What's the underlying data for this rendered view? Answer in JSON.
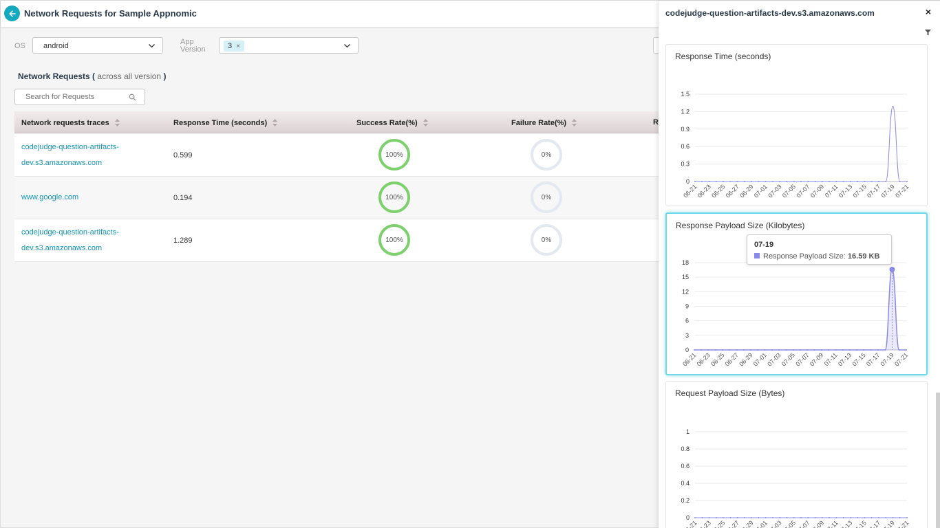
{
  "header": {
    "title": "Network Requests for Sample Appnomic"
  },
  "filters": {
    "os_label": "OS",
    "os_value": "android",
    "app_version_label_1": "App",
    "app_version_label_2": "Version",
    "app_version_tag": "3"
  },
  "section": {
    "title": "Network Requests",
    "paren_open": "(",
    "subtitle": "across all version",
    "paren_close": ")"
  },
  "search": {
    "placeholder": "Search for Requests"
  },
  "table": {
    "columns": [
      "Network requests traces",
      "Response Time (seconds)",
      "Success Rate(%)",
      "Failure Rate(%)",
      "R"
    ],
    "rows": [
      {
        "trace_line1": "codejudge-question-artifacts-",
        "trace_line2": "dev.s3.amazonaws.com",
        "response_time": "0.599",
        "success": "100%",
        "failure": "0%"
      },
      {
        "trace_line1": "www.google.com",
        "trace_line2": "",
        "response_time": "0.194",
        "success": "100%",
        "failure": "0%"
      },
      {
        "trace_line1": "codejudge-question-artifacts-",
        "trace_line2": "dev.s3.amazonaws.com",
        "response_time": "1.289",
        "success": "100%",
        "failure": "0%"
      }
    ]
  },
  "panel": {
    "title": "codejudge-question-artifacts-dev.s3.amazonaws.com",
    "close_label": "×"
  },
  "colors": {
    "accent": "#15a9bf",
    "link": "#1494b4",
    "success": "#7ed06e",
    "series": "#8a8ae6"
  },
  "chart_data": [
    {
      "type": "line",
      "title": "Response Time (seconds)",
      "x": [
        "06-21",
        "06-22",
        "06-23",
        "06-24",
        "06-25",
        "06-26",
        "06-27",
        "06-28",
        "06-29",
        "06-30",
        "07-01",
        "07-02",
        "07-03",
        "07-04",
        "07-05",
        "07-06",
        "07-07",
        "07-08",
        "07-09",
        "07-10",
        "07-11",
        "07-12",
        "07-13",
        "07-14",
        "07-15",
        "07-16",
        "07-17",
        "07-18",
        "07-19",
        "07-20",
        "07-21"
      ],
      "x_tick_labels": [
        "06-21",
        "06-23",
        "06-25",
        "06-27",
        "06-29",
        "07-01",
        "07-03",
        "07-05",
        "07-07",
        "07-09",
        "07-11",
        "07-13",
        "07-15",
        "07-17",
        "07-19",
        "07-21"
      ],
      "y_ticks": [
        "0",
        "0.3",
        "0.6",
        "0.9",
        "1.2",
        "1.5"
      ],
      "ylim": [
        0,
        1.5
      ],
      "series": [
        {
          "values": [
            0,
            0,
            0,
            0,
            0,
            0,
            0,
            0,
            0,
            0,
            0,
            0,
            0,
            0,
            0,
            0,
            0,
            0,
            0,
            0,
            0,
            0,
            0,
            0,
            0,
            0,
            0,
            0,
            1.289,
            0,
            0
          ]
        }
      ]
    },
    {
      "type": "area",
      "title": "Response Payload Size (Kilobytes)",
      "x": [
        "06-21",
        "06-22",
        "06-23",
        "06-24",
        "06-25",
        "06-26",
        "06-27",
        "06-28",
        "06-29",
        "06-30",
        "07-01",
        "07-02",
        "07-03",
        "07-04",
        "07-05",
        "07-06",
        "07-07",
        "07-08",
        "07-09",
        "07-10",
        "07-11",
        "07-12",
        "07-13",
        "07-14",
        "07-15",
        "07-16",
        "07-17",
        "07-18",
        "07-19",
        "07-20",
        "07-21"
      ],
      "x_tick_labels": [
        "06-21",
        "06-23",
        "06-25",
        "06-27",
        "06-29",
        "07-01",
        "07-03",
        "07-05",
        "07-07",
        "07-09",
        "07-11",
        "07-13",
        "07-15",
        "07-17",
        "07-19",
        "07-21"
      ],
      "y_ticks": [
        "0",
        "3",
        "6",
        "9",
        "12",
        "15",
        "18"
      ],
      "ylim": [
        0,
        18
      ],
      "series": [
        {
          "values": [
            0,
            0,
            0,
            0,
            0,
            0,
            0,
            0,
            0,
            0,
            0,
            0,
            0,
            0,
            0,
            0,
            0,
            0,
            0,
            0,
            0,
            0,
            0,
            0,
            0,
            0,
            0,
            0,
            16.59,
            0,
            0
          ]
        }
      ],
      "tooltip": {
        "date": "07-19",
        "label": "Response Payload Size:",
        "value": "16.59 KB"
      }
    },
    {
      "type": "line",
      "title": "Request Payload Size (Bytes)",
      "x": [
        "06-21",
        "06-22",
        "06-23",
        "06-24",
        "06-25",
        "06-26",
        "06-27",
        "06-28",
        "06-29",
        "06-30",
        "07-01",
        "07-02",
        "07-03",
        "07-04",
        "07-05",
        "07-06",
        "07-07",
        "07-08",
        "07-09",
        "07-10",
        "07-11",
        "07-12",
        "07-13",
        "07-14",
        "07-15",
        "07-16",
        "07-17",
        "07-18",
        "07-19",
        "07-20",
        "07-21"
      ],
      "x_tick_labels": [
        "06-21",
        "06-23",
        "06-25",
        "06-27",
        "06-29",
        "07-01",
        "07-03",
        "07-05",
        "07-07",
        "07-09",
        "07-11",
        "07-13",
        "07-15",
        "07-17",
        "07-19",
        "07-21"
      ],
      "y_ticks": [
        "0",
        "0.2",
        "0.4",
        "0.6",
        "0.8",
        "1"
      ],
      "ylim": [
        0,
        1
      ],
      "series": [
        {
          "values": [
            0,
            0,
            0,
            0,
            0,
            0,
            0,
            0,
            0,
            0,
            0,
            0,
            0,
            0,
            0,
            0,
            0,
            0,
            0,
            0,
            0,
            0,
            0,
            0,
            0,
            0,
            0,
            0,
            0,
            0,
            0
          ]
        }
      ]
    }
  ]
}
